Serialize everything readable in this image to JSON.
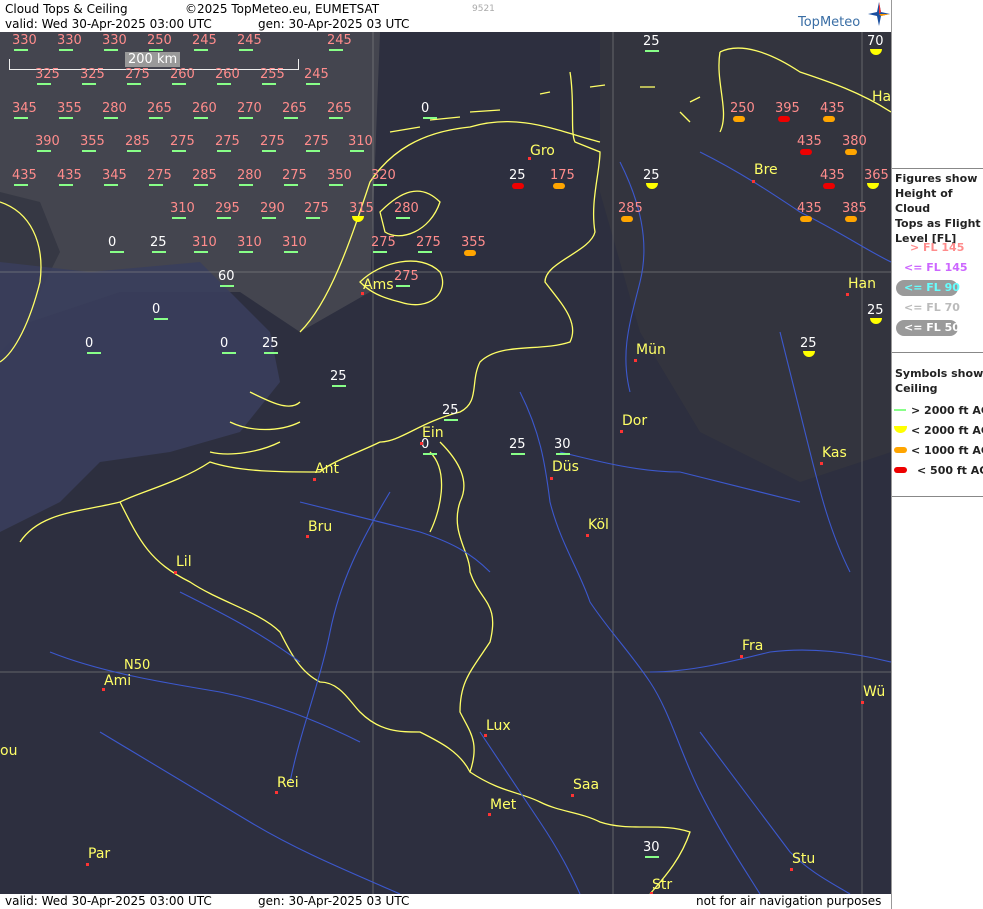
{
  "header": {
    "title": "Cloud Tops & Ceiling",
    "copyright": "©2025 TopMeteo.eu, EUMETSAT",
    "valid": "valid:  Wed  30-Apr-2025  03:00 UTC",
    "gen": "gen: 30-Apr-2025 03 UTC",
    "code": "9521",
    "logo": "TopMeteo"
  },
  "footer": {
    "valid": "valid:  Wed  30-Apr-2025  03:00 UTC",
    "gen": "gen: 30-Apr-2025 03 UTC",
    "disclaimer": "not for air navigation purposes"
  },
  "scale": {
    "label": "200 km"
  },
  "latitude_label": "N50",
  "legend": {
    "figures_title": "Figures show Height of Cloud Tops as Flight Level  [FL]",
    "figures_title_lines": [
      "Figures show",
      "Height of Cloud",
      "Tops as Flight",
      "Level  [FL]"
    ],
    "levels": [
      {
        "label": "> FL 145",
        "color": "#ff8c8c"
      },
      {
        "label": "<= FL 145",
        "color": "#cc66ff"
      },
      {
        "label": "<= FL 90",
        "color": "#66ffff"
      },
      {
        "label": "<= FL 70",
        "color": "#dddddd"
      },
      {
        "label": "<= FL 50",
        "color": "#ffffff"
      }
    ],
    "symbols_title_lines": [
      "Symbols show",
      "Ceiling"
    ],
    "symbols": [
      {
        "label": "> 2000 ft AGL",
        "color": "#88ff88",
        "kind": "line"
      },
      {
        "label": "< 2000 ft AGL",
        "color": "#ffff00",
        "kind": "cap"
      },
      {
        "label": "< 1000 ft AGL",
        "color": "#ffa500",
        "kind": "pill"
      },
      {
        "label": "< 500 ft AGL",
        "color": "#ee0000",
        "kind": "pill"
      }
    ]
  },
  "cities": [
    "Gro",
    "Bre",
    "Ha",
    "Ams",
    "Han",
    "Mün",
    "Dor",
    "Ein",
    "Düs",
    "Kas",
    "Ant",
    "Köl",
    "Bru",
    "Lil",
    "Fra",
    "Ami",
    "Wü",
    "Lux",
    "ou",
    "Rei",
    "Saa",
    "Met",
    "Stu",
    "Par",
    "Str"
  ],
  "observations": [
    "330",
    "330",
    "330",
    "250",
    "245",
    "245",
    "245",
    "25",
    "70",
    "325",
    "325",
    "275",
    "260",
    "260",
    "255",
    "245",
    "345",
    "355",
    "280",
    "265",
    "260",
    "270",
    "265",
    "265",
    "0",
    "250",
    "395",
    "435",
    "Ha",
    "390",
    "355",
    "285",
    "275",
    "275",
    "275",
    "275",
    "310",
    "435",
    "380",
    "435",
    "435",
    "345",
    "275",
    "285",
    "280",
    "275",
    "350",
    "320",
    "25",
    "175",
    "25",
    "435",
    "365",
    "310",
    "295",
    "290",
    "275",
    "315",
    "280",
    "285",
    "435",
    "385",
    "0",
    "25",
    "310",
    "310",
    "310",
    "275",
    "275",
    "355",
    "60",
    "275",
    "25",
    "0",
    "0",
    "0",
    "25",
    "25",
    "25",
    "25",
    "25",
    "30",
    "0",
    "30"
  ]
}
